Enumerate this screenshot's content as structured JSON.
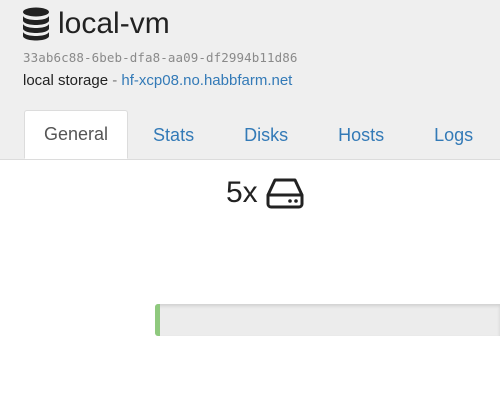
{
  "sr": {
    "name": "local-vm",
    "uuid": "33ab6c88-6beb-dfa8-aa09-df2994b11d86",
    "type": "local storage",
    "separator": "-",
    "host": "hf-xcp08.no.habbfarm.net",
    "icon": "database-icon"
  },
  "tabs": [
    {
      "label": "General",
      "active": true
    },
    {
      "label": "Stats",
      "active": false
    },
    {
      "label": "Disks",
      "active": false
    },
    {
      "label": "Hosts",
      "active": false
    },
    {
      "label": "Logs",
      "active": false
    }
  ],
  "general": {
    "disk_count": "5x",
    "disk_icon": "hard-drive-icon",
    "usage_fraction": 0.015
  },
  "colors": {
    "link": "#337ab7",
    "progress_fill": "#8fc97e",
    "progress_track": "#ececec"
  }
}
